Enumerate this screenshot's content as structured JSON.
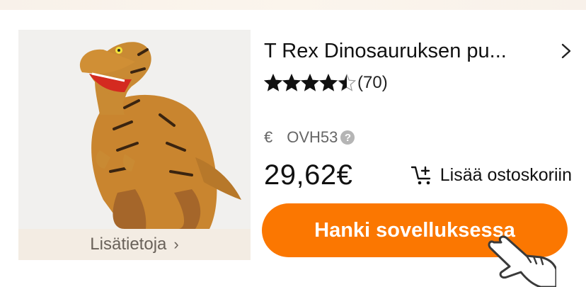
{
  "product": {
    "title": "T Rex Dinosauruksen pu...",
    "rating": 4.5,
    "review_count": "(70)",
    "old_price_currency": "€",
    "old_price_code": "OVH53",
    "help_icon_glyph": "?",
    "price": "29,62€",
    "more_info_label": "Lisätietoja",
    "more_info_chevron": "›",
    "image_icon": "t-rex-costume-image"
  },
  "actions": {
    "add_to_cart_label": "Lisää ostoskoriin",
    "get_app_label": "Hanki sovelluksessa"
  },
  "colors": {
    "accent": "#fb7701",
    "image_bg": "#f1f0ee",
    "info_strip": "#f3ece3"
  }
}
